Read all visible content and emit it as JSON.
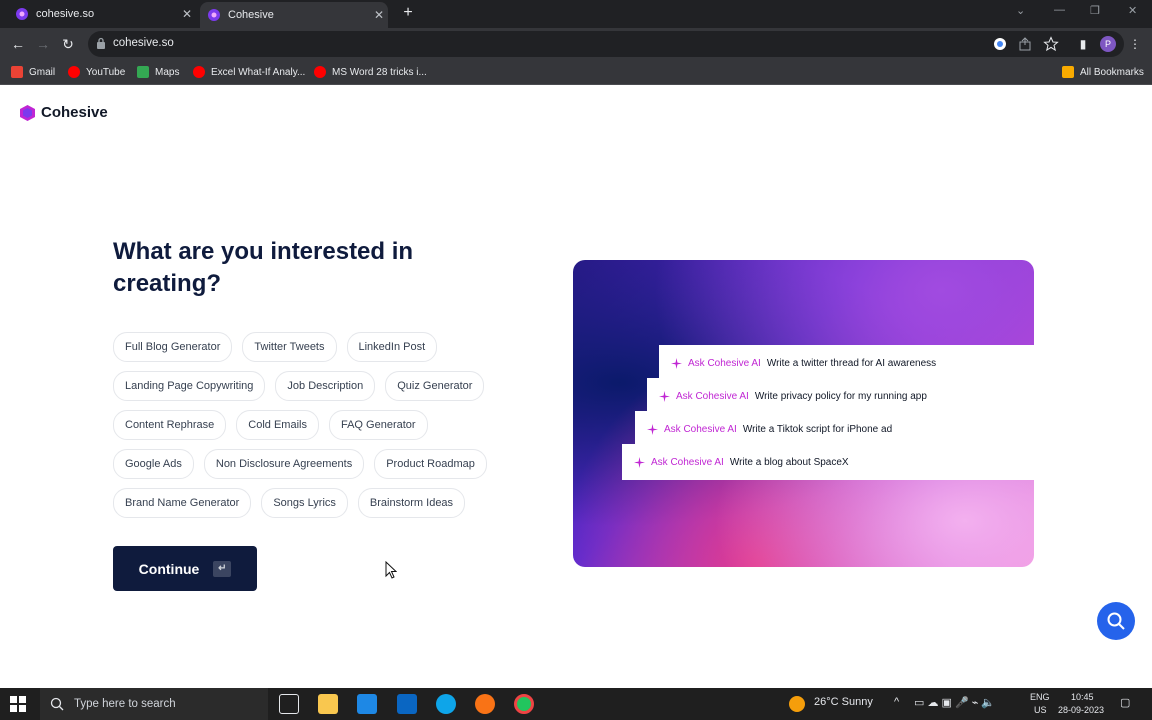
{
  "browser": {
    "tabs": [
      {
        "title": "cohesive.so"
      },
      {
        "title": "Cohesive"
      }
    ],
    "url": "cohesive.so",
    "bookmarks": [
      "Gmail",
      "YouTube",
      "Maps",
      "Excel What-If Analy...",
      "MS Word 28 tricks i..."
    ],
    "all_bookmarks": "All Bookmarks",
    "profile_initial": "P"
  },
  "page": {
    "brand": "Cohesive",
    "heading": "What are you interested in creating?",
    "chip_rows": [
      [
        "Full Blog Generator",
        "Twitter Tweets",
        "LinkedIn Post"
      ],
      [
        "Landing Page Copywriting",
        "Job Description",
        "Quiz Generator"
      ],
      [
        "Content Rephrase",
        "Cold Emails",
        "FAQ Generator"
      ],
      [
        "Google Ads",
        "Non Disclosure Agreements",
        "Product Roadmap"
      ],
      [
        "Brand Name Generator",
        "Songs Lyrics",
        "Brainstorm Ideas"
      ]
    ],
    "continue_label": "Continue",
    "continue_key": "↵",
    "prompts": [
      {
        "ask": "Ask Cohesive AI",
        "text": "Write a twitter thread for AI awareness"
      },
      {
        "ask": "Ask Cohesive AI",
        "text": "Write privacy policy for my running app"
      },
      {
        "ask": "Ask Cohesive AI",
        "text": "Write a Tiktok script for iPhone ad"
      },
      {
        "ask": "Ask Cohesive AI",
        "text": "Write a blog about SpaceX"
      }
    ]
  },
  "taskbar": {
    "search_placeholder": "Type here to search",
    "weather": "26°C  Sunny",
    "lang_top": "ENG",
    "lang_bottom": "US",
    "time": "10:45",
    "date": "28-09-2023"
  },
  "colors": {
    "primary_navy": "#0f1b3d",
    "accent_magenta": "#c026d3",
    "fab_blue": "#2563eb"
  }
}
